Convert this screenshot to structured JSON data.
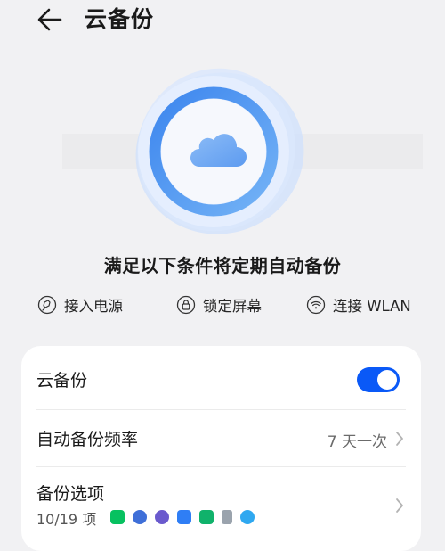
{
  "header": {
    "title": "云备份",
    "back_icon": "arrow-left-icon"
  },
  "hero": {
    "icon": "cloud-icon",
    "ring_color": "#5a9ff2",
    "glow_color": "#b9d2fb"
  },
  "conditions": {
    "title": "满足以下条件将定期自动备份",
    "items": [
      {
        "icon": "power-plug-icon",
        "label": "接入电源"
      },
      {
        "icon": "lock-icon",
        "label": "锁定屏幕"
      },
      {
        "icon": "wifi-icon",
        "label": "连接 WLAN"
      }
    ]
  },
  "settings": {
    "cloud_backup": {
      "label": "云备份",
      "enabled": true
    },
    "frequency": {
      "label": "自动备份频率",
      "value": "7 天一次"
    },
    "options": {
      "label": "备份选项",
      "count": "10/19 项"
    }
  },
  "colors": {
    "accent": "#0a59f7",
    "background": "#f1f1f3",
    "card": "#ffffff"
  }
}
